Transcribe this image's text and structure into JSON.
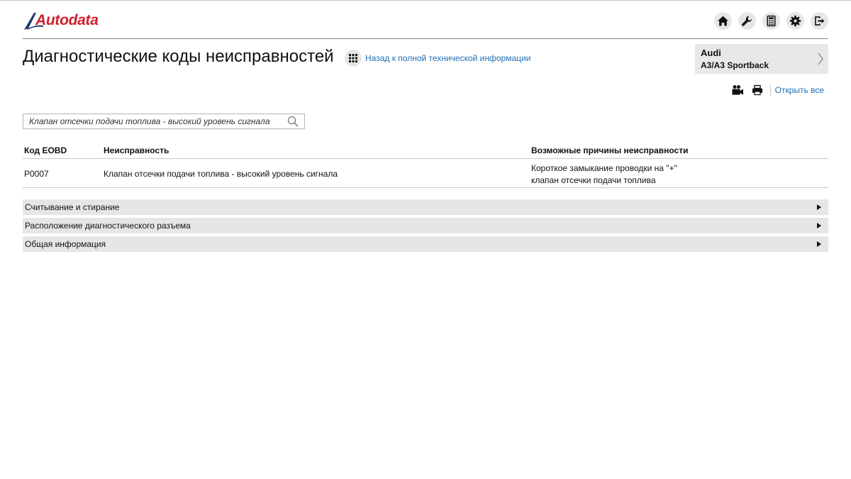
{
  "header": {
    "logo_text": "Autodata",
    "icons": [
      "home-icon",
      "wrench-icon",
      "calculator-icon",
      "gear-icon",
      "logout-icon"
    ]
  },
  "page": {
    "title": "Диагностические коды неисправностей",
    "back_link": "Назад к полной технической информации"
  },
  "vehicle": {
    "make": "Audi",
    "model": "A3/A3 Sportback"
  },
  "tools": {
    "open_all": "Открыть все"
  },
  "search": {
    "value": "Клапан отсечки подачи топлива - высокий уровень сигнала"
  },
  "table": {
    "headers": [
      "Код EOBD",
      "Неисправность",
      "Возможные причины неисправности"
    ],
    "rows": [
      {
        "code": "P0007",
        "fault": "Клапан отсечки подачи топлива - высокий уровень сигнала",
        "causes": [
          "Короткое замыкание проводки на \"+\"",
          "клапан отсечки подачи топлива"
        ]
      }
    ]
  },
  "sections": [
    {
      "label": "Считывание и стирание"
    },
    {
      "label": "Расположение диагностического разъема"
    },
    {
      "label": "Общая информация"
    }
  ],
  "colors": {
    "brand_red": "#cf1f2e",
    "brand_navy": "#1d3a6e",
    "link_blue": "#1f6fb5",
    "panel_gray": "#e6e6e6"
  }
}
